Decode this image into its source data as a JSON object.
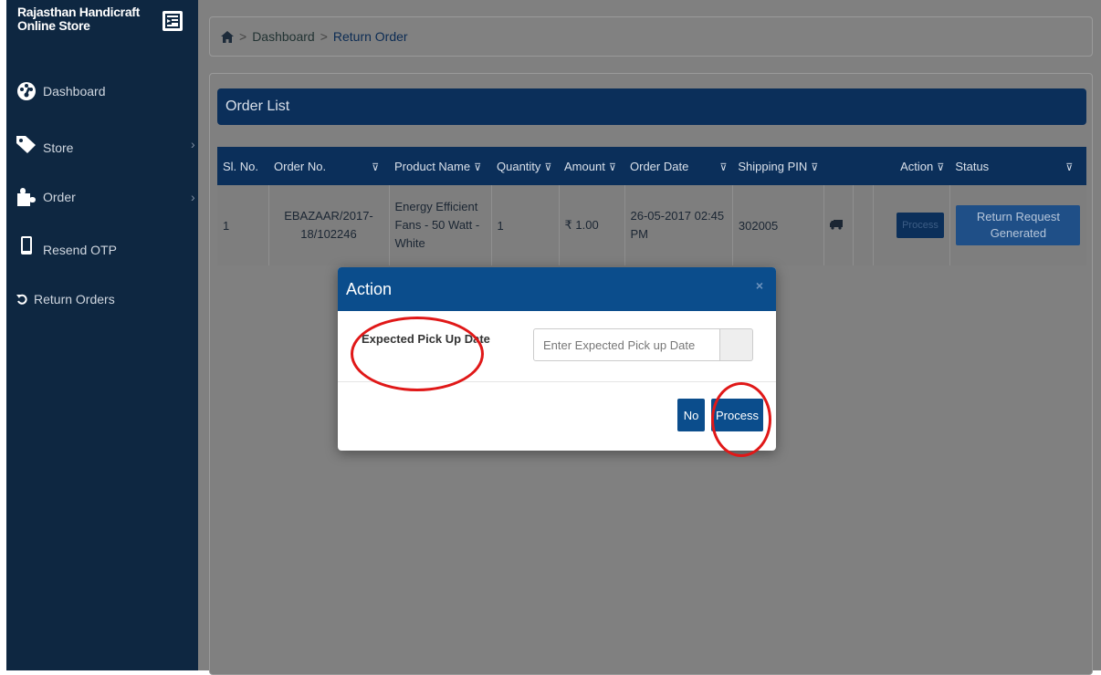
{
  "sidebar": {
    "brand_line1": "Rajasthan Handicraft",
    "brand_line2": "Online Store",
    "items": [
      {
        "label": "Dashboard",
        "icon": "dashboard-icon"
      },
      {
        "label": "Store",
        "icon": "tag-icon"
      },
      {
        "label": "Order",
        "icon": "puzzle-icon"
      },
      {
        "label": "Resend OTP",
        "icon": "mobile-icon"
      },
      {
        "label": "Return Orders",
        "icon": "undo-icon"
      }
    ]
  },
  "breadcrumb": {
    "dashboard": "Dashboard",
    "current": "Return Order",
    "separator": ">"
  },
  "panel": {
    "title": "Order List"
  },
  "table": {
    "headers": {
      "sl_no": "Sl. No.",
      "order_no": "Order No.",
      "product_name": "Product Name",
      "quantity": "Quantity",
      "amount": "Amount",
      "order_date": "Order Date",
      "shipping_pin": "Shipping PIN",
      "action": "Action",
      "status": "Status"
    },
    "filter_glyph": "⊽",
    "rows": [
      {
        "sl_no": "1",
        "order_no": "EBAZAAR/2017-18/102246",
        "product_name": "Energy Efficient Fans - 50 Watt - White",
        "quantity": "1",
        "amount": "₹ 1.00",
        "order_date": "26-05-2017 02:45 PM",
        "shipping_pin": "302005",
        "action_label": "Process",
        "status_label": "Return Request Generated"
      }
    ]
  },
  "modal": {
    "title": "Action",
    "close": "×",
    "field_label": "Expected Pick Up Date",
    "placeholder": "Enter Expected Pick up Date",
    "no_label": "No",
    "process_label": "Process"
  },
  "colors": {
    "sidebar_bg": "#0e2741",
    "header_bg": "#0b2f5a",
    "modal_header": "#0b4d8c",
    "annotation": "#e01818"
  }
}
